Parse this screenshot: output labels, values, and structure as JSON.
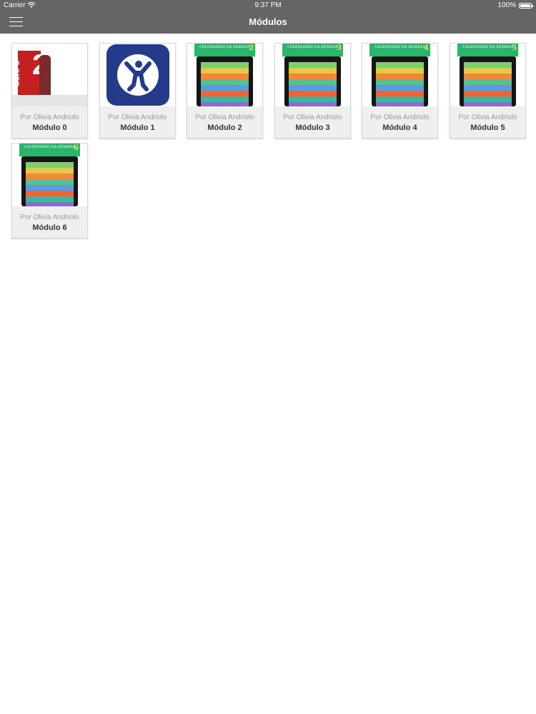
{
  "status_bar": {
    "carrier": "Carrier",
    "time": "9:37 PM",
    "battery": "100%"
  },
  "nav": {
    "title": "Módulos",
    "menu_icon": "hamburger-menu-icon"
  },
  "modules": [
    {
      "author": "Por Olivia Andriolo",
      "name": "Módulo 0",
      "thumb": "corpo21"
    },
    {
      "author": "Por Olivia Andriolo",
      "name": "Módulo 1",
      "thumb": "app-icon"
    },
    {
      "author": "Por Olivia Andriolo",
      "name": "Módulo 2",
      "thumb": "calendar",
      "number": "2"
    },
    {
      "author": "Por Olivia Andriolo",
      "name": "Módulo 3",
      "thumb": "calendar",
      "number": "3"
    },
    {
      "author": "Por Olivia Andriolo",
      "name": "Módulo 4",
      "thumb": "calendar",
      "number": "4"
    },
    {
      "author": "Por Olivia Andriolo",
      "name": "Módulo 5",
      "thumb": "calendar",
      "number": "5"
    },
    {
      "author": "Por Olivia Andriolo",
      "name": "Módulo 6",
      "thumb": "calendar",
      "number": "6"
    }
  ],
  "thumb_text": {
    "corpo_word": "CORPO",
    "corpo_number": "21",
    "calendar_title": "CALENDÁRIO DA SEMANA"
  },
  "colors": {
    "bar": "#656565",
    "calendar_header": "#2bb56c",
    "calendar_bands": [
      "#7fcf6b",
      "#e9c64a",
      "#f08a3a",
      "#5bbf8f",
      "#5b9be0",
      "#e8683c",
      "#3fb5a0",
      "#8a6bd0"
    ]
  }
}
